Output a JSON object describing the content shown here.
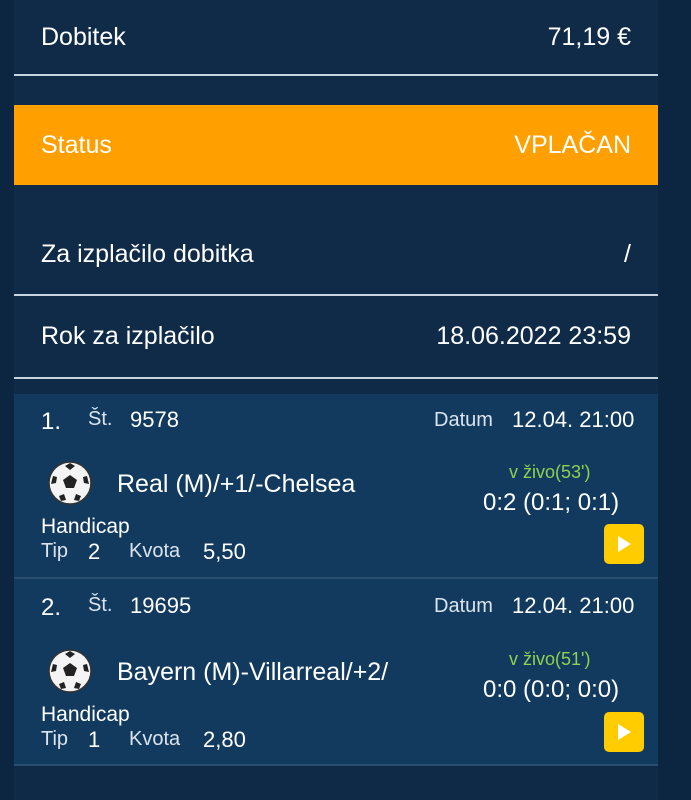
{
  "summary": {
    "winnings_label": "Dobitek",
    "winnings_value": "71,19 €",
    "status_label": "Status",
    "status_value": "VPLAČAN",
    "payout_label": "Za izplačilo dobitka",
    "payout_value": "/",
    "deadline_label": "Rok za izplačilo",
    "deadline_value": "18.06.2022 23:59"
  },
  "labels": {
    "number": "Št.",
    "date": "Datum",
    "tip": "Tip",
    "odds": "Kvota"
  },
  "bets": [
    {
      "index": "1.",
      "number": "9578",
      "date": "12.04. 21:00",
      "match": "Real (M)/+1/-Chelsea",
      "live": "v živo(53')",
      "score": "0:2 (0:1; 0:1)",
      "market": "Handicap",
      "tip": "2",
      "odds": "5,50"
    },
    {
      "index": "2.",
      "number": "19695",
      "date": "12.04. 21:00",
      "match": "Bayern (M)-Villarreal/+2/",
      "live": "v živo(51')",
      "score": "0:0 (0:0; 0:0)",
      "market": "Handicap",
      "tip": "1",
      "odds": "2,80"
    }
  ],
  "colors": {
    "background": "#0e2a47",
    "status_bg": "#ff9f00",
    "bet_bg": "#113a5e",
    "live_text": "#8fd14f",
    "play_button": "#ffcc00"
  }
}
